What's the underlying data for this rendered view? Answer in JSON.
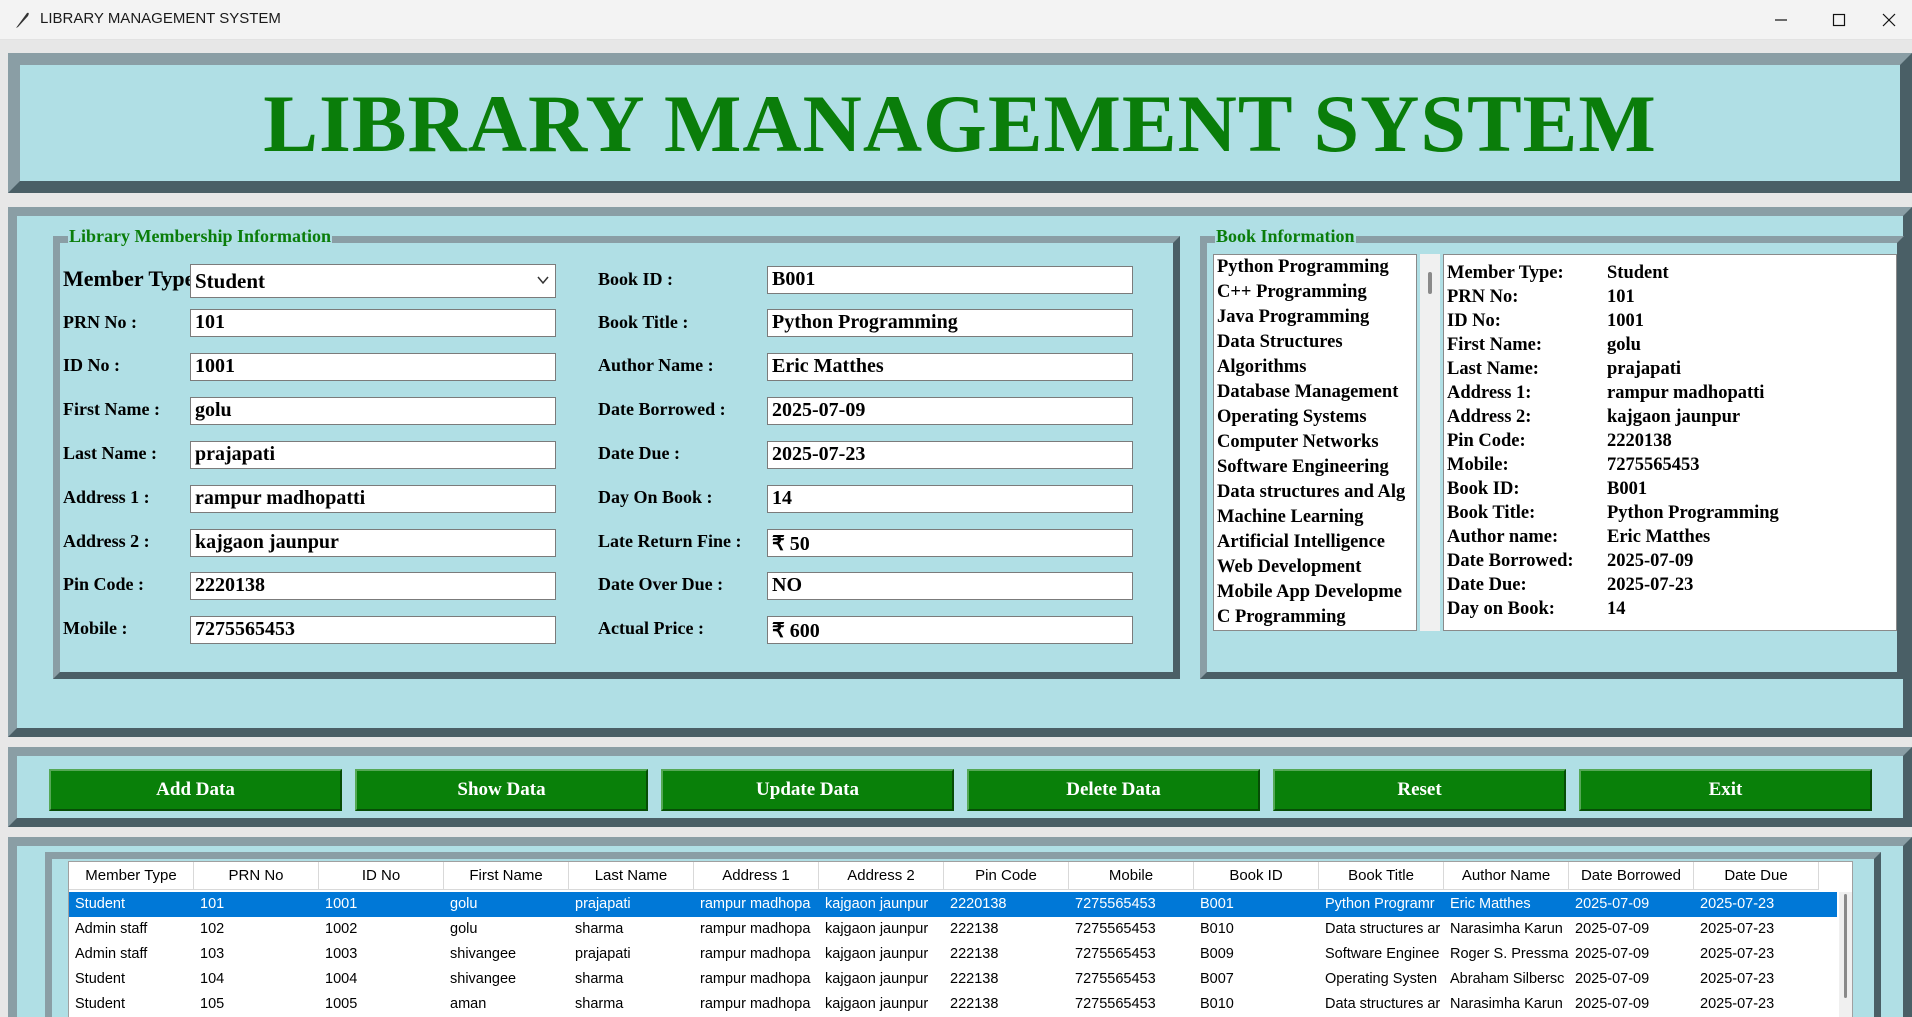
{
  "window": {
    "title": "LIBRARY MANAGEMENT SYSTEM"
  },
  "header": {
    "title": "LIBRARY MANAGEMENT SYSTEM"
  },
  "membership": {
    "frame_title": "Library Membership Information",
    "member_type_label": "Member Type",
    "member_type_value": "Student",
    "fields": [
      {
        "label": "PRN No :",
        "value": "101"
      },
      {
        "label": "ID No :",
        "value": "1001"
      },
      {
        "label": "First Name :",
        "value": "golu"
      },
      {
        "label": "Last Name :",
        "value": "prajapati"
      },
      {
        "label": "Address 1 :",
        "value": "rampur madhopatti"
      },
      {
        "label": "Address 2 :",
        "value": "kajgaon jaunpur"
      },
      {
        "label": "Pin Code :",
        "value": "2220138"
      },
      {
        "label": "Mobile :",
        "value": "7275565453"
      }
    ],
    "book_fields": [
      {
        "label": "Book ID :",
        "value": "B001"
      },
      {
        "label": "Book Title :",
        "value": "Python Programming"
      },
      {
        "label": "Author Name :",
        "value": "Eric Matthes"
      },
      {
        "label": "Date Borrowed :",
        "value": "2025-07-09"
      },
      {
        "label": "Date Due :",
        "value": "2025-07-23"
      },
      {
        "label": "Day On Book :",
        "value": "14"
      },
      {
        "label": "Late Return Fine :",
        "value": "₹ 50"
      },
      {
        "label": "Date Over Due :",
        "value": "NO"
      },
      {
        "label": "Actual Price :",
        "value": "₹ 600"
      }
    ]
  },
  "book_info": {
    "frame_title": "Book Information",
    "books": [
      "Python Programming",
      "C++ Programming",
      "Java Programming",
      "Data Structures",
      "Algorithms",
      "Database Management",
      "Operating Systems",
      "Computer Networks",
      "Software Engineering",
      "Data structures and Alg",
      "Machine Learning",
      "Artificial Intelligence",
      "Web Development",
      "Mobile App Developme",
      "C Programming"
    ],
    "details": [
      {
        "k": "Member Type:",
        "v": "Student"
      },
      {
        "k": "PRN No:",
        "v": "101"
      },
      {
        "k": "ID No:",
        "v": "1001"
      },
      {
        "k": "First Name:",
        "v": "golu"
      },
      {
        "k": "Last Name:",
        "v": "prajapati"
      },
      {
        "k": "Address 1:",
        "v": "rampur madhopatti"
      },
      {
        "k": "Address 2:",
        "v": "kajgaon jaunpur"
      },
      {
        "k": "Pin Code:",
        "v": "2220138"
      },
      {
        "k": "Mobile:",
        "v": "7275565453"
      },
      {
        "k": "Book ID:",
        "v": "B001"
      },
      {
        "k": "Book Title:",
        "v": "Python Programming"
      },
      {
        "k": "Author name:",
        "v": "Eric Matthes"
      },
      {
        "k": "Date Borrowed:",
        "v": "2025-07-09"
      },
      {
        "k": "Date Due:",
        "v": "2025-07-23"
      },
      {
        "k": "Day on Book:",
        "v": "14"
      }
    ]
  },
  "buttons": [
    "Add Data",
    "Show Data",
    "Update Data",
    "Delete Data",
    "Reset",
    "Exit"
  ],
  "table": {
    "headers": [
      "Member Type",
      "PRN No",
      "ID No",
      "First Name",
      "Last Name",
      "Address 1",
      "Address 2",
      "Pin Code",
      "Mobile",
      "Book ID",
      "Book Title",
      "Author Name",
      "Date Borrowed",
      "Date Due"
    ],
    "rows": [
      [
        "Student",
        "101",
        "1001",
        "golu",
        "prajapati",
        "rampur madhopa",
        "kajgaon jaunpur",
        "2220138",
        "7275565453",
        "B001",
        "Python Programr",
        "Eric Matthes",
        "2025-07-09",
        "2025-07-23"
      ],
      [
        "Admin staff",
        "102",
        "1002",
        "golu",
        "sharma",
        "rampur madhopa",
        "kajgaon jaunpur",
        "222138",
        "7275565453",
        "B010",
        "Data structures ar",
        "Narasimha Karun",
        "2025-07-09",
        "2025-07-23"
      ],
      [
        "Admin staff",
        "103",
        "1003",
        "shivangee",
        "prajapati",
        "rampur madhopa",
        "kajgaon jaunpur",
        "222138",
        "7275565453",
        "B009",
        "Software Enginee",
        "Roger S. Pressmar",
        "2025-07-09",
        "2025-07-23"
      ],
      [
        "Student",
        "104",
        "1004",
        "shivangee",
        "sharma",
        "rampur madhopa",
        "kajgaon jaunpur",
        "222138",
        "7275565453",
        "B007",
        "Operating Systen",
        "Abraham Silbersc",
        "2025-07-09",
        "2025-07-23"
      ],
      [
        "Student",
        "105",
        "1005",
        "aman",
        "sharma",
        "rampur madhopa",
        "kajgaon jaunpur",
        "222138",
        "7275565453",
        "B010",
        "Data structures ar",
        "Narasimha Karun",
        "2025-07-09",
        "2025-07-23"
      ]
    ],
    "selected_row": 0
  },
  "colors": {
    "panel_bg": "#b0dfe5",
    "accent_green": "#0a7d0a",
    "button_green": "#098009",
    "selection_blue": "#0078d7"
  }
}
